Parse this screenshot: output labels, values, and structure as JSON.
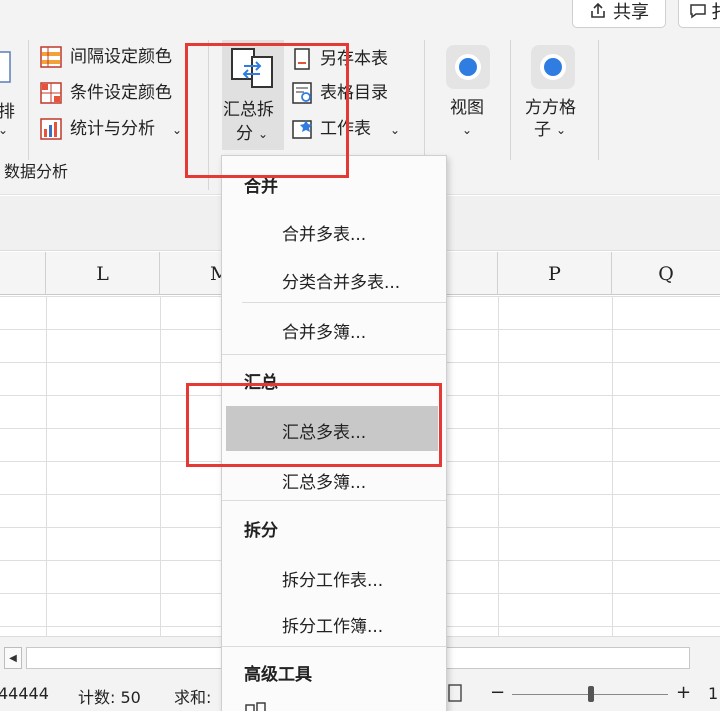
{
  "topbar": {
    "share_label": "共享",
    "btn2_label": "扌"
  },
  "ribbon": {
    "left_cut": "排",
    "items": [
      "间隔设定颜色",
      "条件设定颜色",
      "统计与分析"
    ],
    "group_label": "数据分析",
    "summary_split": {
      "line1": "汇总拆",
      "line2": "分"
    },
    "more": [
      "另存本表",
      "表格目录",
      "工作表"
    ],
    "view_label": "视图",
    "fangge": {
      "line1": "方方格",
      "line2": "子"
    },
    "chevron": "⌄"
  },
  "sheet": {
    "columns": [
      "L",
      "M",
      "P",
      "Q"
    ]
  },
  "menu": {
    "sections": [
      {
        "title": "合并",
        "items": [
          "合并多表...",
          "分类合并多表...",
          "合并多簿..."
        ]
      },
      {
        "title": "汇总",
        "items": [
          "汇总多表...",
          "汇总多簿..."
        ]
      },
      {
        "title": "拆分",
        "items": [
          "拆分工作表...",
          "拆分工作簿..."
        ]
      },
      {
        "title": "高级工具",
        "items": []
      }
    ],
    "selected_item": "汇总多表..."
  },
  "status": {
    "left_value": "44444",
    "count": "计数: 50",
    "sum": "求和:",
    "plus": "+",
    "minus": "−",
    "right_cut": "1"
  },
  "colors": {
    "highlight_red": "#e53935",
    "menu_selected": "#c8c8c8",
    "ribbon_bg": "#f3f3f3"
  }
}
